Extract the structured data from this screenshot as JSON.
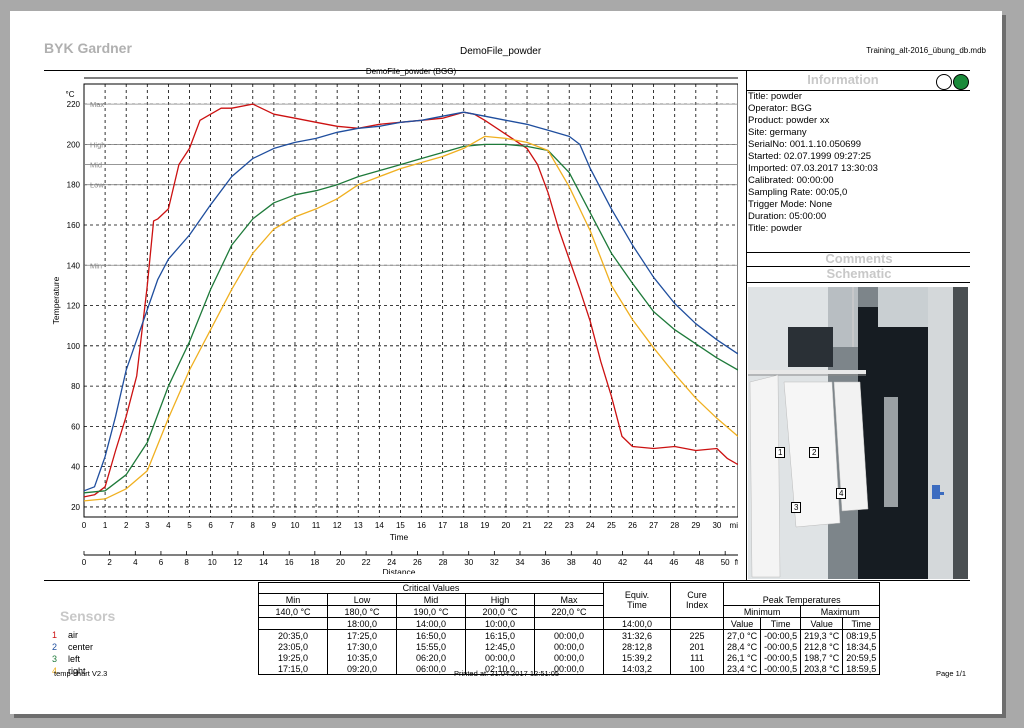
{
  "header": {
    "brand": "BYK Gardner",
    "title": "DemoFile_powder",
    "file": "Training_alt-2016_übung_db.mdb"
  },
  "info": {
    "heading": "Information",
    "lines": [
      "Title: powder",
      "Operator: BGG",
      "Product: powder xx",
      "Site: germany",
      "SerialNo: 001.1.10.050699",
      "Started: 02.07.1999 09:27:25",
      "Imported: 07.03.2017 13:30:03",
      "Calibrated: 00:00:00",
      "Sampling Rate: 00:05,0",
      "Trigger Mode: None",
      "Duration: 05:00:00",
      "Title: powder"
    ],
    "comments_heading": "Comments",
    "schematic_heading": "Schematic",
    "status_colors": [
      "#ffffff",
      "#1a8a3a"
    ],
    "photo_labels": [
      "1",
      "2",
      "3",
      "4"
    ]
  },
  "chart_data": {
    "type": "line",
    "title": "DemoFile_powder (BGG)",
    "xlabel": "Time",
    "x_unit": "min",
    "ylabel": "Temperature",
    "y_unit": "°C",
    "xlim": [
      0,
      31
    ],
    "ylim": [
      15,
      230
    ],
    "x_ticks": [
      0,
      1,
      2,
      3,
      4,
      5,
      6,
      7,
      8,
      9,
      10,
      11,
      12,
      13,
      14,
      15,
      16,
      17,
      18,
      19,
      20,
      21,
      22,
      23,
      24,
      25,
      26,
      27,
      28,
      29,
      30
    ],
    "y_ticks": [
      20,
      40,
      60,
      80,
      100,
      120,
      140,
      160,
      180,
      200,
      220
    ],
    "grid": true,
    "distance_axis": {
      "label": "Distance",
      "ticks": [
        "0",
        "2",
        "4",
        "6",
        "8",
        "10",
        "12",
        "14",
        "16",
        "18",
        "20",
        "22",
        "24",
        "26",
        "28",
        "30",
        "32",
        "34",
        "36",
        "38",
        "40",
        "42",
        "44",
        "46",
        "48",
        "50"
      ],
      "end_label": "ft"
    },
    "reference_lines": [
      {
        "name": "Max",
        "value": 220
      },
      {
        "name": "High",
        "value": 200
      },
      {
        "name": "Mid",
        "value": 190
      },
      {
        "name": "Low",
        "value": 180
      },
      {
        "name": "Min",
        "value": 140
      }
    ],
    "series": [
      {
        "name": "air",
        "color": "#cc1111",
        "x": [
          0,
          0.5,
          1,
          1.5,
          2,
          2.5,
          3,
          3.3,
          3.5,
          4,
          4.5,
          5,
          5.5,
          6,
          6.5,
          7,
          8,
          9,
          10,
          11,
          12,
          13,
          14,
          15,
          16,
          17,
          18,
          18.5,
          19,
          20,
          21,
          21.5,
          22,
          22.5,
          23,
          23.5,
          24,
          24.5,
          25,
          25.5,
          26,
          27,
          28,
          29,
          30,
          30.5,
          31
        ],
        "y": [
          25,
          26,
          30,
          48,
          65,
          85,
          130,
          162,
          163,
          168,
          190,
          198,
          212,
          215,
          218,
          218,
          220,
          215,
          213,
          211,
          209,
          208,
          210,
          211,
          212,
          213,
          216,
          215,
          212,
          205,
          198,
          190,
          176,
          158,
          143,
          128,
          112,
          92,
          75,
          55,
          50,
          49,
          50,
          48,
          49,
          44,
          41
        ]
      },
      {
        "name": "center",
        "color": "#1f4e9e",
        "x": [
          0,
          0.5,
          1,
          1.5,
          2,
          2.5,
          3,
          3.5,
          4,
          5,
          6,
          7,
          8,
          9,
          10,
          11,
          12,
          13,
          14,
          15,
          16,
          17,
          18,
          19,
          20,
          21,
          22,
          23,
          23.5,
          24,
          25,
          26,
          27,
          28,
          29,
          30,
          31
        ],
        "y": [
          28,
          30,
          45,
          65,
          88,
          103,
          118,
          133,
          143,
          155,
          170,
          184,
          193,
          198,
          201,
          203,
          206,
          208,
          209,
          211,
          212,
          214,
          216,
          214,
          212,
          210,
          207,
          204,
          200,
          188,
          168,
          150,
          134,
          121,
          111,
          103,
          96
        ]
      },
      {
        "name": "left",
        "color": "#1e7a3a",
        "x": [
          0,
          1,
          2,
          3,
          4,
          5,
          6,
          7,
          8,
          9,
          10,
          11,
          12,
          13,
          14,
          15,
          16,
          17,
          18,
          19,
          20,
          21,
          22,
          23,
          24,
          25,
          26,
          27,
          28,
          29,
          30,
          31
        ],
        "y": [
          27,
          28,
          36,
          52,
          80,
          102,
          128,
          150,
          163,
          171,
          175,
          177,
          180,
          184,
          187,
          190,
          193,
          196,
          199,
          200,
          200,
          199,
          197,
          186,
          166,
          146,
          131,
          117,
          108,
          101,
          94,
          88
        ]
      },
      {
        "name": "right",
        "color": "#f0b020",
        "x": [
          0,
          1,
          2,
          3,
          4,
          5,
          6,
          7,
          8,
          9,
          10,
          11,
          12,
          13,
          14,
          15,
          16,
          17,
          18,
          19,
          20,
          21,
          22,
          23,
          24,
          25,
          26,
          27,
          28,
          29,
          30,
          31
        ],
        "y": [
          23,
          24,
          29,
          38,
          64,
          88,
          108,
          128,
          146,
          158,
          164,
          168,
          173,
          180,
          184,
          188,
          191,
          194,
          198,
          204,
          203,
          201,
          197,
          179,
          157,
          130,
          113,
          99,
          86,
          74,
          64,
          55
        ]
      }
    ]
  },
  "table": {
    "sensors_heading": "Sensors",
    "critical_heading": "Critical Values",
    "columns": [
      "Min",
      "Low",
      "Mid",
      "High",
      "Max"
    ],
    "thresholds": [
      "140,0 °C",
      "180,0 °C",
      "190,0 °C",
      "200,0 °C",
      "220,0 °C"
    ],
    "durations": [
      "",
      "18:00,0",
      "14:00,0",
      "10:00,0",
      ""
    ],
    "equiv_heading": "Equiv.",
    "equiv_sub": "Time",
    "equiv_value": "14:00,0",
    "cure_heading": "Cure",
    "cure_sub": "Index",
    "peak_heading": "Peak Temperatures",
    "minimum": "Minimum",
    "maximum": "Maximum",
    "value_h": "Value",
    "time_h": "Time",
    "rows": [
      {
        "num": "1",
        "name": "air",
        "color": "#cc1111",
        "vals": [
          "20:35,0",
          "17:25,0",
          "16:50,0",
          "16:15,0",
          "00:00,0"
        ],
        "equiv": "31:32,6",
        "cure": "225",
        "min_v": "27,0 °C",
        "min_t": "-00:00,5",
        "max_v": "219,3 °C",
        "max_t": "08:19,5"
      },
      {
        "num": "2",
        "name": "center",
        "color": "#1f4e9e",
        "vals": [
          "23:05,0",
          "17:30,0",
          "15:55,0",
          "12:45,0",
          "00:00,0"
        ],
        "equiv": "28:12,8",
        "cure": "201",
        "min_v": "28,4 °C",
        "min_t": "-00:00,5",
        "max_v": "212,8 °C",
        "max_t": "18:34,5"
      },
      {
        "num": "3",
        "name": "left",
        "color": "#1e7a3a",
        "vals": [
          "19:25,0",
          "10:35,0",
          "06:20,0",
          "00:00,0",
          "00:00,0"
        ],
        "equiv": "15:39,2",
        "cure": "111",
        "min_v": "26,1 °C",
        "min_t": "-00:00,5",
        "max_v": "198,7 °C",
        "max_t": "20:59,5"
      },
      {
        "num": "4",
        "name": "right",
        "color": "#f0b020",
        "vals": [
          "17:15,0",
          "09:20,0",
          "06:00,0",
          "02:10,0",
          "00:00,0"
        ],
        "equiv": "14:03,2",
        "cure": "100",
        "min_v": "23,4 °C",
        "min_t": "-00:00,5",
        "max_v": "203,8 °C",
        "max_t": "18:59,5"
      }
    ]
  },
  "footer": {
    "version": "temp-chart V2.3",
    "printed": "Printed at: 21.04.2017 12:51:05",
    "page": "Page 1/1"
  }
}
